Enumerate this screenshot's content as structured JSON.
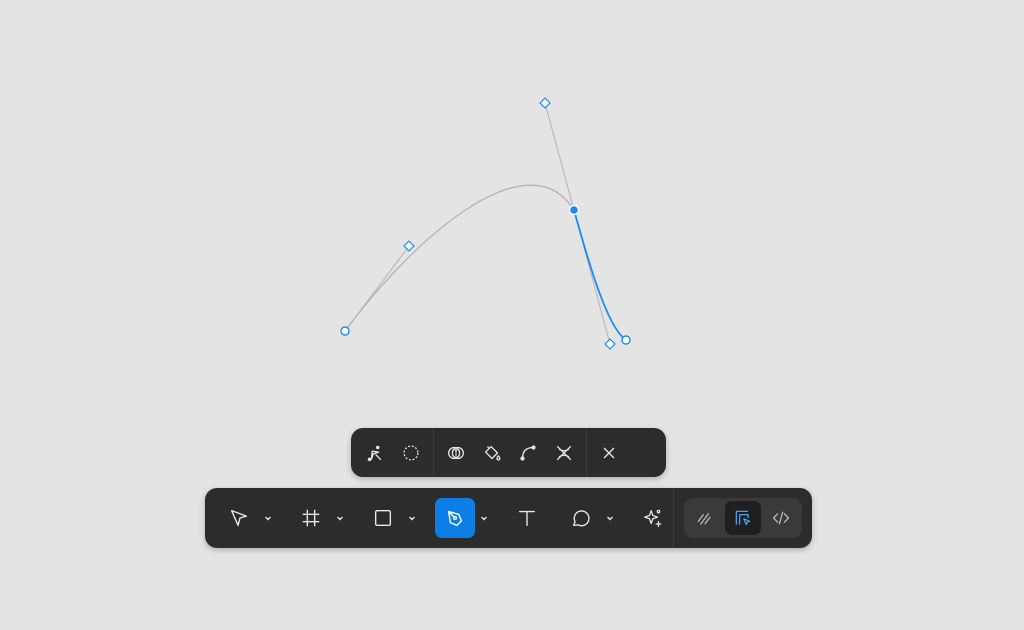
{
  "canvas": {
    "selected_path_color": "#1a8cf0",
    "unselected_path_color": "#b3b3b3"
  },
  "vector_toolbar": {
    "tools": [
      {
        "name": "bend-tool",
        "icon": "bend-icon"
      },
      {
        "name": "lasso-tool",
        "icon": "lasso-icon"
      },
      {
        "name": "shape-builder-tool",
        "icon": "shape-builder-icon"
      },
      {
        "name": "paint-bucket-tool",
        "icon": "paint-bucket-icon"
      },
      {
        "name": "path-tool",
        "icon": "path-icon"
      },
      {
        "name": "cut-tool",
        "icon": "cut-icon"
      }
    ],
    "close_icon": "close-icon"
  },
  "main_toolbar": {
    "tools": [
      {
        "name": "move-tool",
        "icon": "cursor-icon",
        "has_menu": true
      },
      {
        "name": "frame-tool",
        "icon": "frame-icon",
        "has_menu": true
      },
      {
        "name": "rectangle-tool",
        "icon": "rectangle-icon",
        "has_menu": true
      },
      {
        "name": "pen-tool",
        "icon": "pen-icon",
        "has_menu": true,
        "active": true
      },
      {
        "name": "text-tool",
        "icon": "text-icon",
        "has_menu": false
      },
      {
        "name": "comment-tool",
        "icon": "comment-icon",
        "has_menu": true
      },
      {
        "name": "ai-tool",
        "icon": "sparkle-icon",
        "has_menu": false
      }
    ],
    "modes": [
      {
        "name": "draw-mode",
        "icon": "draw-icon"
      },
      {
        "name": "design-mode",
        "icon": "design-icon",
        "active": true
      },
      {
        "name": "dev-mode",
        "icon": "code-icon"
      }
    ],
    "accent_color": "#0d7ee6"
  }
}
